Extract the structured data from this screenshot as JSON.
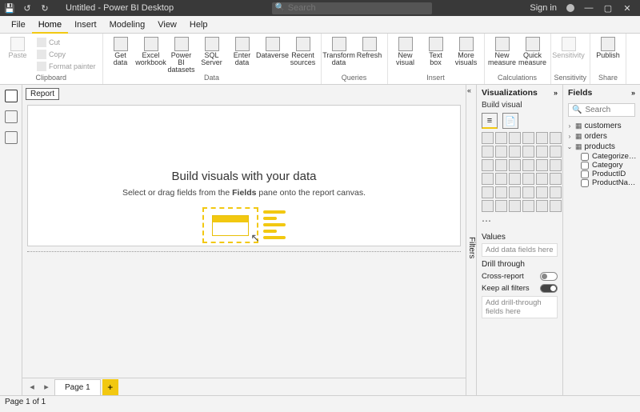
{
  "titlebar": {
    "title": "Untitled - Power BI Desktop",
    "search_placeholder": "Search",
    "signin": "Sign in"
  },
  "tabs": [
    "File",
    "Home",
    "Insert",
    "Modeling",
    "View",
    "Help"
  ],
  "active_tab": "Home",
  "ribbon": {
    "clipboard": {
      "label": "Clipboard",
      "paste": "Paste",
      "cut": "Cut",
      "copy": "Copy",
      "painter": "Format painter"
    },
    "data": {
      "label": "Data",
      "items": [
        "Get\ndata",
        "Excel\nworkbook",
        "Power BI\ndatasets",
        "SQL\nServer",
        "Enter\ndata",
        "Dataverse",
        "Recent\nsources"
      ]
    },
    "queries": {
      "label": "Queries",
      "items": [
        "Transform\ndata",
        "Refresh"
      ]
    },
    "insert": {
      "label": "Insert",
      "items": [
        "New\nvisual",
        "Text\nbox",
        "More\nvisuals"
      ]
    },
    "calc": {
      "label": "Calculations",
      "items": [
        "New\nmeasure",
        "Quick\nmeasure"
      ]
    },
    "sens": {
      "label": "Sensitivity",
      "items": [
        "Sensitivity"
      ]
    },
    "share": {
      "label": "Share",
      "items": [
        "Publish"
      ]
    }
  },
  "canvas": {
    "report": "Report",
    "heading": "Build visuals with your data",
    "sub_pre": "Select or drag fields from the ",
    "sub_bold": "Fields",
    "sub_post": " pane onto the report canvas.",
    "page1": "Page 1"
  },
  "filters": "Filters",
  "viz": {
    "title": "Visualizations",
    "build": "Build visual",
    "values": "Values",
    "values_ph": "Add data fields here",
    "drill": "Drill through",
    "cross": "Cross-report",
    "keep": "Keep all filters",
    "drill_ph": "Add drill-through fields here"
  },
  "fields": {
    "title": "Fields",
    "search_ph": "Search",
    "tables": [
      {
        "name": "customers",
        "expanded": false
      },
      {
        "name": "orders",
        "expanded": false
      },
      {
        "name": "products",
        "expanded": true,
        "cols": [
          "Categorized Pro...",
          "Category",
          "ProductID",
          "ProductName"
        ]
      }
    ]
  },
  "status": "Page 1 of 1"
}
